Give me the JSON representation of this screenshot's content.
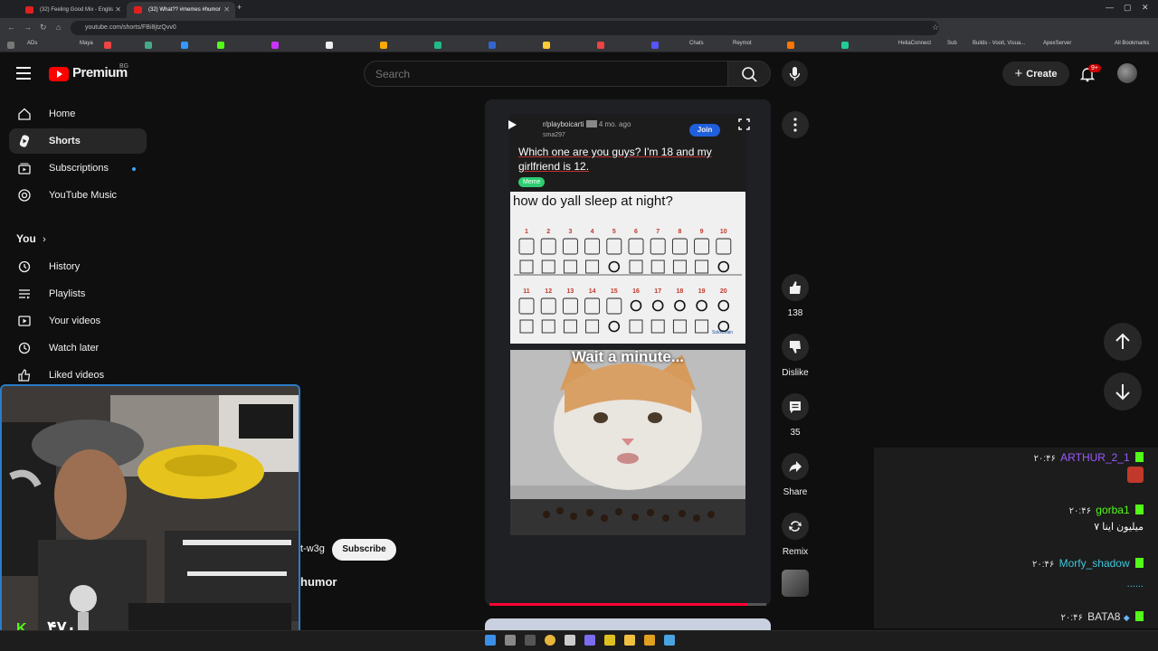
{
  "browser": {
    "tabs": [
      {
        "label": "(32) Feeling Good Mix - Englis"
      },
      {
        "label": "(32) What?? #memes #humor"
      }
    ],
    "url": "youtube.com/shorts/FBi8jtzQvv0",
    "bookmarks": [
      "ADs",
      "Maya",
      "Chats",
      "Reymot",
      "HeliaConnect",
      "Sub",
      "Builds - Vooit, Visua...",
      "ApexServer",
      "All Bookmarks"
    ]
  },
  "header": {
    "logo": "Premium",
    "country": "BG",
    "search_placeholder": "Search",
    "create_label": "Create",
    "notification_count": "9+"
  },
  "sidebar": {
    "items": [
      {
        "label": "Home",
        "icon": "home-icon"
      },
      {
        "label": "Shorts",
        "icon": "shorts-icon"
      },
      {
        "label": "Subscriptions",
        "icon": "subscriptions-icon"
      },
      {
        "label": "YouTube Music",
        "icon": "music-icon"
      }
    ],
    "you_label": "You",
    "you_items": [
      {
        "label": "History",
        "icon": "history-icon"
      },
      {
        "label": "Playlists",
        "icon": "playlists-icon"
      },
      {
        "label": "Your videos",
        "icon": "your-videos-icon"
      },
      {
        "label": "Watch later",
        "icon": "watch-later-icon"
      },
      {
        "label": "Liked videos",
        "icon": "liked-icon"
      }
    ]
  },
  "short": {
    "post_meta": "r/playboicarti",
    "post_age": "4 mo. ago",
    "post_user": "sma297",
    "post_title": "Which one are you guys? I'm 18 and my girlfriend is 12.",
    "flair": "Meme",
    "join_label": "Join",
    "meme_question": "how do yall sleep at night?",
    "row1_numbers": [
      "1",
      "2",
      "3",
      "4",
      "5",
      "6",
      "7",
      "8",
      "9",
      "10"
    ],
    "row2_numbers": [
      "11",
      "12",
      "13",
      "14",
      "15",
      "16",
      "17",
      "18",
      "19",
      "20"
    ],
    "meme_source": "SoloChain",
    "cat_caption": "Wait a minute...",
    "progress": 0.93
  },
  "below_cam": {
    "channel_partial": "t-w3g",
    "subscribe_label": "Subscribe",
    "title_partial": "humor"
  },
  "actions": {
    "likes": "138",
    "dislike_label": "Dislike",
    "comments": "35",
    "share_label": "Share",
    "remix_label": "Remix"
  },
  "webcam": {
    "score": "۴۷۰"
  },
  "chat": {
    "messages": [
      {
        "time": "۲۰:۴۶",
        "name": "ARTHUR_2_1",
        "color": "#9b59ff",
        "text": ""
      },
      {
        "time": "۲۰:۴۶",
        "name": "gorba1",
        "color": "#53fc18",
        "text": "۷ میلیون اینا"
      },
      {
        "time": "۲۰:۴۶",
        "name": "Morfy_shadow",
        "color": "#3ec6d8",
        "text": "......"
      },
      {
        "time": "۲۰:۴۶",
        "name": "BATA8",
        "color": "#e0e0e0",
        "text": ""
      }
    ]
  },
  "colors": {
    "accent_red": "#ff0000",
    "kick_green": "#53fc18",
    "join_blue": "#1f5fdc"
  }
}
